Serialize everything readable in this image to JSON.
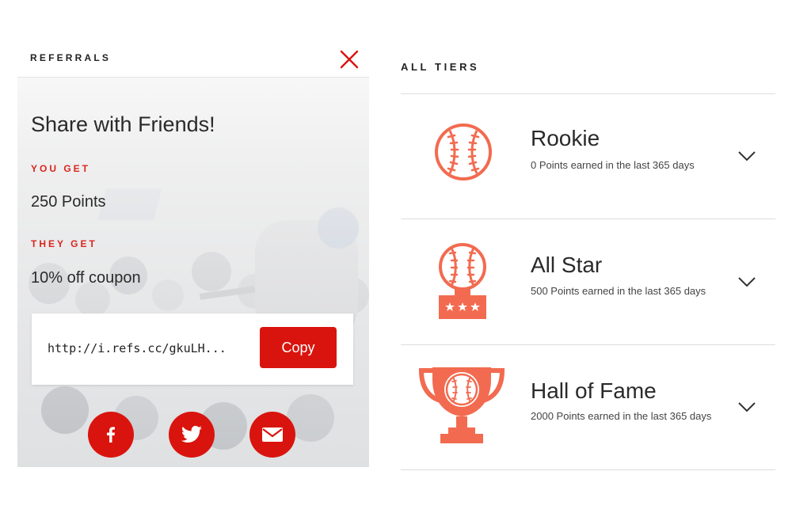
{
  "referrals": {
    "title": "REFERRALS",
    "heading": "Share with Friends!",
    "you_get_label": "YOU GET",
    "you_get_value": "250 Points",
    "they_get_label": "THEY GET",
    "they_get_value": "10% off coupon",
    "referral_link": "http://i.refs.cc/gkuLH...",
    "copy_label": "Copy",
    "close_icon": "close-icon",
    "share_icons": [
      "facebook-icon",
      "twitter-icon",
      "email-icon"
    ]
  },
  "tiers": {
    "title": "ALL TIERS",
    "items": [
      {
        "name": "Rookie",
        "description": "0 Points earned in the last 365 days",
        "icon": "baseball-icon"
      },
      {
        "name": "All Star",
        "description": "500 Points earned in the last 365 days",
        "icon": "baseball-trophy-icon"
      },
      {
        "name": "Hall of Fame",
        "description": "2000 Points earned in the last 365 days",
        "icon": "baseball-cup-icon"
      }
    ]
  },
  "colors": {
    "accent_red": "#d9140e",
    "tier_icon": "#f26b50",
    "text_dark": "#2a2a2a"
  }
}
